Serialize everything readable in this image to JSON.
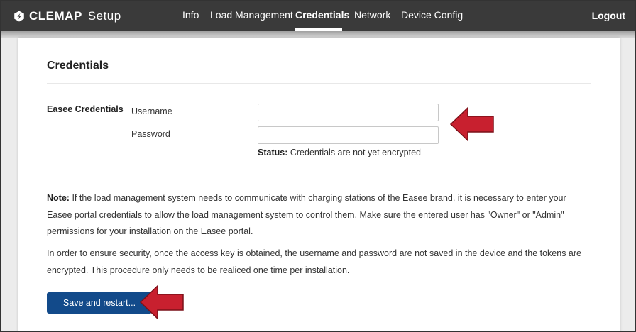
{
  "navbar": {
    "brand_name": "CLEMAP",
    "brand_sub": "Setup",
    "links": [
      {
        "label": "Info"
      },
      {
        "label": "Load Management"
      },
      {
        "label": "Credentials"
      },
      {
        "label": "Network"
      },
      {
        "label": "Device Config"
      }
    ],
    "active_index": 2,
    "logout_label": "Logout"
  },
  "page": {
    "title": "Credentials",
    "section_label": "Easee Credentials",
    "fields": {
      "username": {
        "label": "Username",
        "value": ""
      },
      "password": {
        "label": "Password",
        "value": ""
      }
    },
    "status": {
      "label": "Status:",
      "text": "Credentials are not yet encrypted"
    },
    "note": {
      "label": "Note:",
      "text": "If the load management system needs to communicate with charging stations of the Easee brand, it is necessary to enter your Easee portal credentials to allow the load management system to control them. Make sure the entered user has \"Owner\" or \"Admin\" permissions for your installation on the Easee portal."
    },
    "security_text": "In order to ensure security, once the access key is obtained, the username and password are not saved in the device and the tokens are encrypted. This procedure only needs to be realiced one time per installation.",
    "save_label": "Save and restart..."
  },
  "colors": {
    "navbar_bg": "#3a3a3a",
    "primary_button": "#124a8a",
    "annotation_arrow": "#c8202f"
  },
  "icons": {
    "brand": "clemap-logo-icon",
    "annotation": "red-arrow-icon"
  }
}
